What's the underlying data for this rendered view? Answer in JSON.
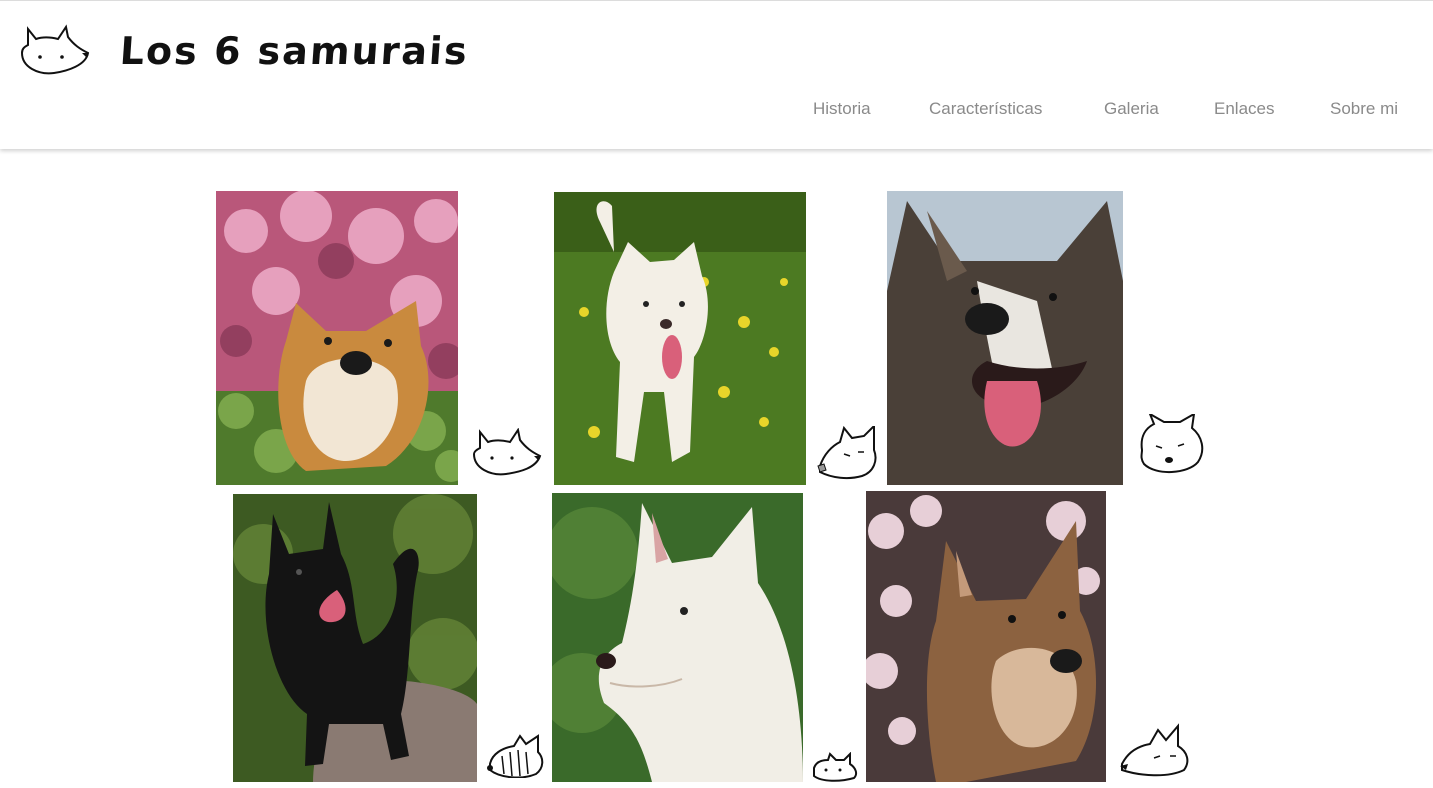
{
  "header": {
    "logo_icon": "fox-dog-doodle-icon",
    "title": "Los 6 samurais"
  },
  "nav": {
    "items": [
      {
        "label": "Historia"
      },
      {
        "label": "Características"
      },
      {
        "label": "Galeria"
      },
      {
        "label": "Enlaces"
      },
      {
        "label": "Sobre mi"
      }
    ]
  },
  "gallery": {
    "photos": [
      {
        "subject": "shiba-inu",
        "palette": {
          "bg": "#b9577a",
          "leaf": "#4f7a2c",
          "fur": "#c98a3e",
          "face": "#f2e6d4"
        }
      },
      {
        "subject": "white-kishu",
        "palette": {
          "bg": "#4c7a22",
          "flower": "#e8d52a",
          "fur": "#f3efe6"
        }
      },
      {
        "subject": "akita-brindle",
        "palette": {
          "bg": "#b8c6d2",
          "fur": "#4a4038",
          "face": "#e9e6e0",
          "tongue": "#d9607a"
        }
      },
      {
        "subject": "black-kai",
        "palette": {
          "bg": "#3d5a22",
          "fur": "#141414",
          "rock": "#8a7a72"
        }
      },
      {
        "subject": "white-hokkaido",
        "palette": {
          "bg": "#3a6a2a",
          "fur": "#f1eee6"
        }
      },
      {
        "subject": "shikoku-sesame",
        "palette": {
          "bg": "#4a3a3a",
          "blossom": "#e7cfd7",
          "fur": "#8c6240"
        }
      }
    ],
    "doodle_icons": [
      "dog-head-doodle-icon",
      "dog-head-doodle-icon",
      "dog-head-doodle-icon",
      "striped-dog-doodle-icon",
      "small-dog-doodle-icon",
      "dog-head-doodle-icon"
    ]
  }
}
